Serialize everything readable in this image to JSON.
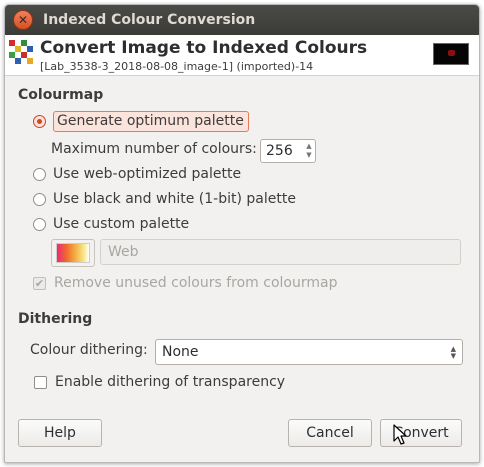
{
  "window": {
    "title": "Indexed Colour Conversion",
    "close_icon": "close-icon"
  },
  "header": {
    "title": "Convert Image to Indexed Colours",
    "subtitle": "[Lab_3538-3_2018-08-08_image-1] (imported)-14",
    "icon": "gimp-indexed-grid-icon",
    "thumbnail": "image-thumbnail"
  },
  "colourmap": {
    "label": "Colourmap",
    "options": {
      "optimum": "Generate optimum palette",
      "web": "Use web-optimized palette",
      "bw": "Use black and white (1-bit) palette",
      "custom": "Use custom palette"
    },
    "selected": "optimum",
    "max_colours_label": "Maximum number of colours:",
    "max_colours_value": "256",
    "custom_palette_name": "Web",
    "remove_unused_label": "Remove unused colours from colourmap",
    "remove_unused_checked": true
  },
  "dithering": {
    "label": "Dithering",
    "colour_dithering_label": "Colour dithering:",
    "colour_dithering_value": "None",
    "transparency_label": "Enable dithering of transparency",
    "transparency_checked": false
  },
  "buttons": {
    "help": "Help",
    "cancel": "Cancel",
    "convert": "Convert"
  },
  "colors": {
    "accent": "#d9451a",
    "titlebar": "#3b3b38"
  }
}
